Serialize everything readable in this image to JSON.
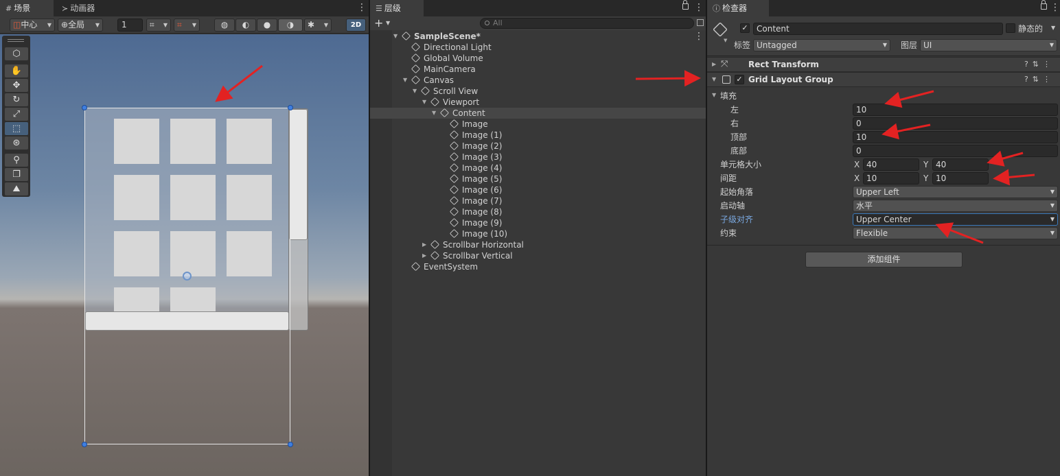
{
  "scene": {
    "tab_scene": "场景",
    "tab_animator": "动画器",
    "pivot_label": "中心",
    "space_label": "全局",
    "grid_value": "1",
    "mode_2d": "2D"
  },
  "hierarchy": {
    "tab_title": "层级",
    "search_placeholder": "All",
    "items": [
      {
        "label": "SampleScene*",
        "depth": 0,
        "fold": "open",
        "bold": true
      },
      {
        "label": "Directional Light",
        "depth": 1
      },
      {
        "label": "Global Volume",
        "depth": 1
      },
      {
        "label": "MainCamera",
        "depth": 1
      },
      {
        "label": "Canvas",
        "depth": 1,
        "fold": "open"
      },
      {
        "label": "Scroll View",
        "depth": 2,
        "fold": "open"
      },
      {
        "label": "Viewport",
        "depth": 3,
        "fold": "open"
      },
      {
        "label": "Content",
        "depth": 4,
        "fold": "open",
        "selected": true
      },
      {
        "label": "Image",
        "depth": 5
      },
      {
        "label": "Image (1)",
        "depth": 5
      },
      {
        "label": "Image (2)",
        "depth": 5
      },
      {
        "label": "Image (3)",
        "depth": 5
      },
      {
        "label": "Image (4)",
        "depth": 5
      },
      {
        "label": "Image (5)",
        "depth": 5
      },
      {
        "label": "Image (6)",
        "depth": 5
      },
      {
        "label": "Image (7)",
        "depth": 5
      },
      {
        "label": "Image (8)",
        "depth": 5
      },
      {
        "label": "Image (9)",
        "depth": 5
      },
      {
        "label": "Image (10)",
        "depth": 5
      },
      {
        "label": "Scrollbar Horizontal",
        "depth": 3,
        "fold": "closed"
      },
      {
        "label": "Scrollbar Vertical",
        "depth": 3,
        "fold": "closed"
      },
      {
        "label": "EventSystem",
        "depth": 1
      }
    ]
  },
  "inspector": {
    "tab_title": "检查器",
    "object_name": "Content",
    "static_label": "静态的",
    "tag_label": "标签",
    "tag_value": "Untagged",
    "layer_label": "图层",
    "layer_value": "UI",
    "rect_transform": "Rect Transform",
    "grid_layout": "Grid Layout Group",
    "padding_label": "填充",
    "left_label": "左",
    "left_value": "10",
    "right_label": "右",
    "right_value": "0",
    "top_label": "顶部",
    "top_value": "10",
    "bottom_label": "底部",
    "bottom_value": "0",
    "cell_size_label": "单元格大小",
    "cell_x": "40",
    "cell_y": "40",
    "spacing_label": "间距",
    "spacing_x": "10",
    "spacing_y": "10",
    "x_label": "X",
    "y_label": "Y",
    "start_corner_label": "起始角落",
    "start_corner_value": "Upper Left",
    "start_axis_label": "启动轴",
    "start_axis_value": "水平",
    "child_align_label": "子级对齐",
    "child_align_value": "Upper Center",
    "constraint_label": "约束",
    "constraint_value": "Flexible",
    "add_component": "添加组件"
  },
  "colors": {
    "annotation_arrow": "#e32222",
    "selection_blue": "#46607c",
    "handle_blue": "#3f7fe0"
  }
}
